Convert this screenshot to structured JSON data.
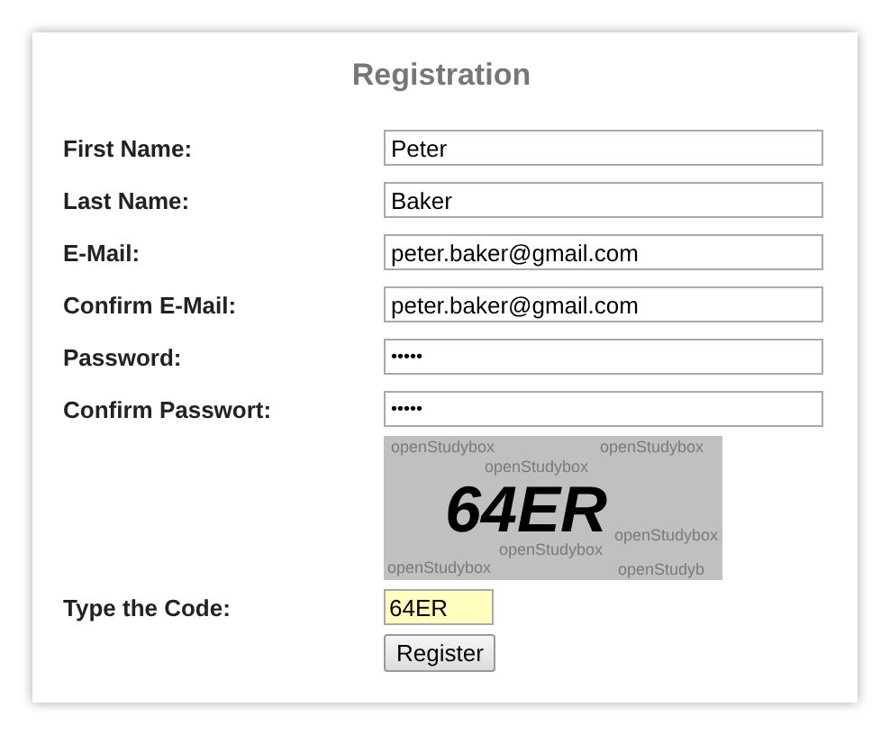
{
  "title": "Registration",
  "fields": [
    {
      "label": "First Name:",
      "value": "Peter",
      "kind": "text"
    },
    {
      "label": "Last Name:",
      "value": "Baker",
      "kind": "text"
    },
    {
      "label": "E-Mail:",
      "value": "peter.baker@gmail.com",
      "kind": "text"
    },
    {
      "label": "Confirm E-Mail:",
      "value": "peter.baker@gmail.com",
      "kind": "text"
    },
    {
      "label": "Password:",
      "value": "•••••",
      "kind": "password"
    },
    {
      "label": "Confirm Passwort:",
      "value": "•••••",
      "kind": "password"
    }
  ],
  "captcha": {
    "code": "64ER",
    "noise": [
      "openStudybox",
      "openStudybox",
      "openStudybox",
      "openStudybox",
      "openStudybox",
      "openStudybox",
      "openStudyb"
    ]
  },
  "code_field": {
    "label": "Type the Code:",
    "value": "64ER"
  },
  "buttons": [
    "Register"
  ]
}
